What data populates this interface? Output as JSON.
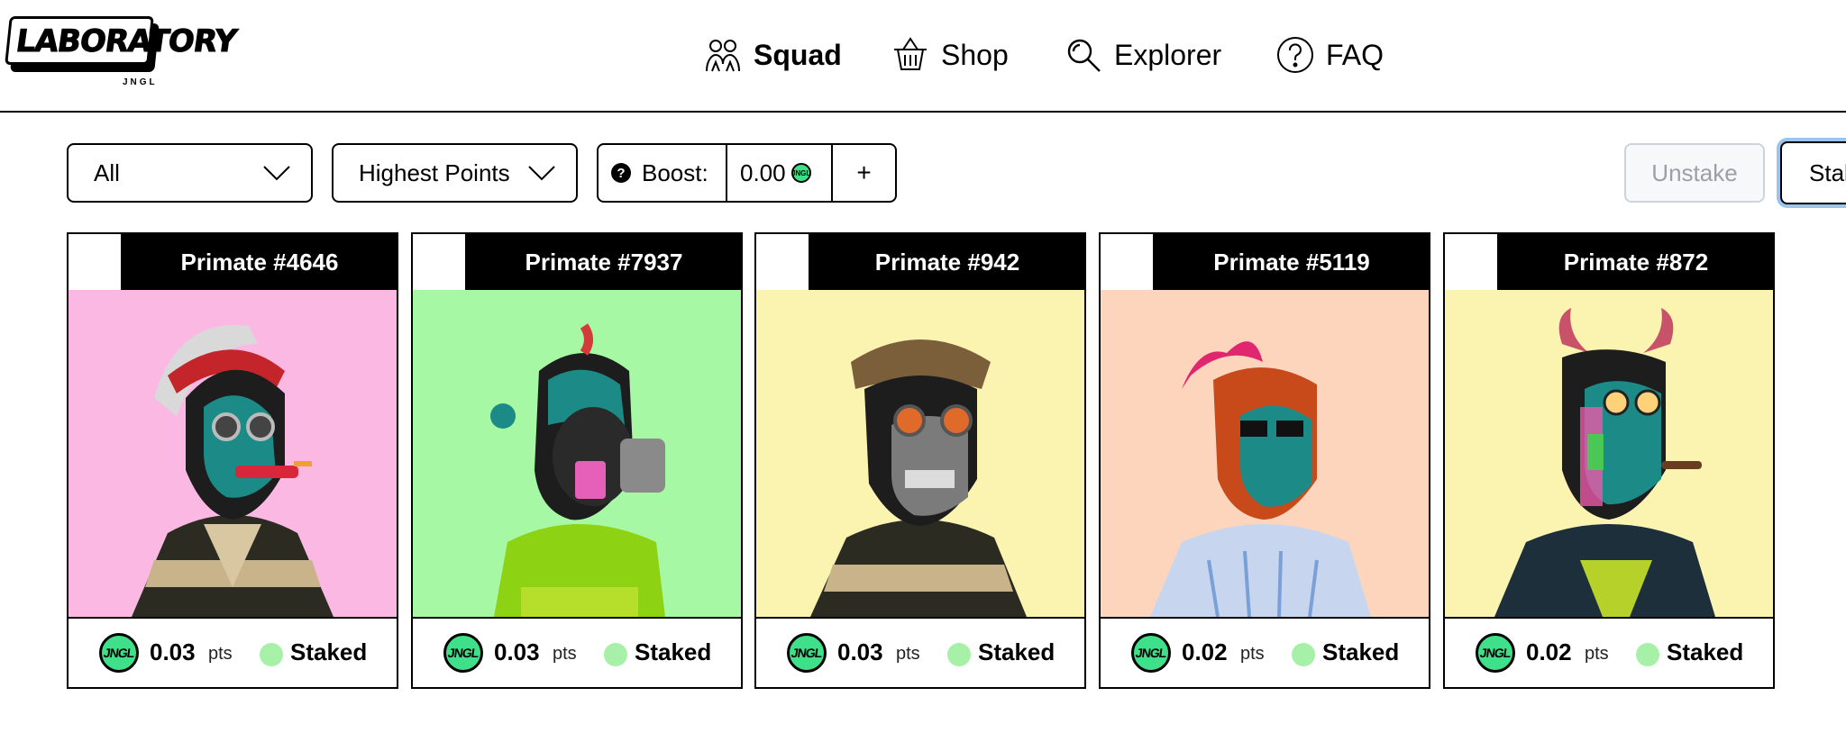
{
  "logo": {
    "word": "LABORATORY",
    "sub": "JNGL"
  },
  "nav": [
    {
      "label": "Squad",
      "icon": "people-icon",
      "active": true
    },
    {
      "label": "Shop",
      "icon": "basket-icon"
    },
    {
      "label": "Explorer",
      "icon": "search-icon"
    },
    {
      "label": "FAQ",
      "icon": "question-circle-icon"
    }
  ],
  "toolbar": {
    "filter_value": "All",
    "sort_value": "Highest Points",
    "boost_label": "Boost:",
    "boost_value": "0.00",
    "boost_add": "+",
    "unstake_label": "Unstake",
    "stake_label": "Stak"
  },
  "colors": {
    "coin": "#3fe08a",
    "staked_dot": "#a6f0a8",
    "focus_ring": "#9ac4ea"
  },
  "cards": [
    {
      "title": "Primate #4646",
      "points": "0.03",
      "unit": "pts",
      "status": "Staked",
      "bg": "#fbb8e3"
    },
    {
      "title": "Primate #7937",
      "points": "0.03",
      "unit": "pts",
      "status": "Staked",
      "bg": "#a7f8a4"
    },
    {
      "title": "Primate #942",
      "points": "0.03",
      "unit": "pts",
      "status": "Staked",
      "bg": "#fbf4b1"
    },
    {
      "title": "Primate #5119",
      "points": "0.02",
      "unit": "pts",
      "status": "Staked",
      "bg": "#fdd5bd"
    },
    {
      "title": "Primate #872",
      "points": "0.02",
      "unit": "pts",
      "status": "Staked",
      "bg": "#fbf4b1"
    }
  ]
}
